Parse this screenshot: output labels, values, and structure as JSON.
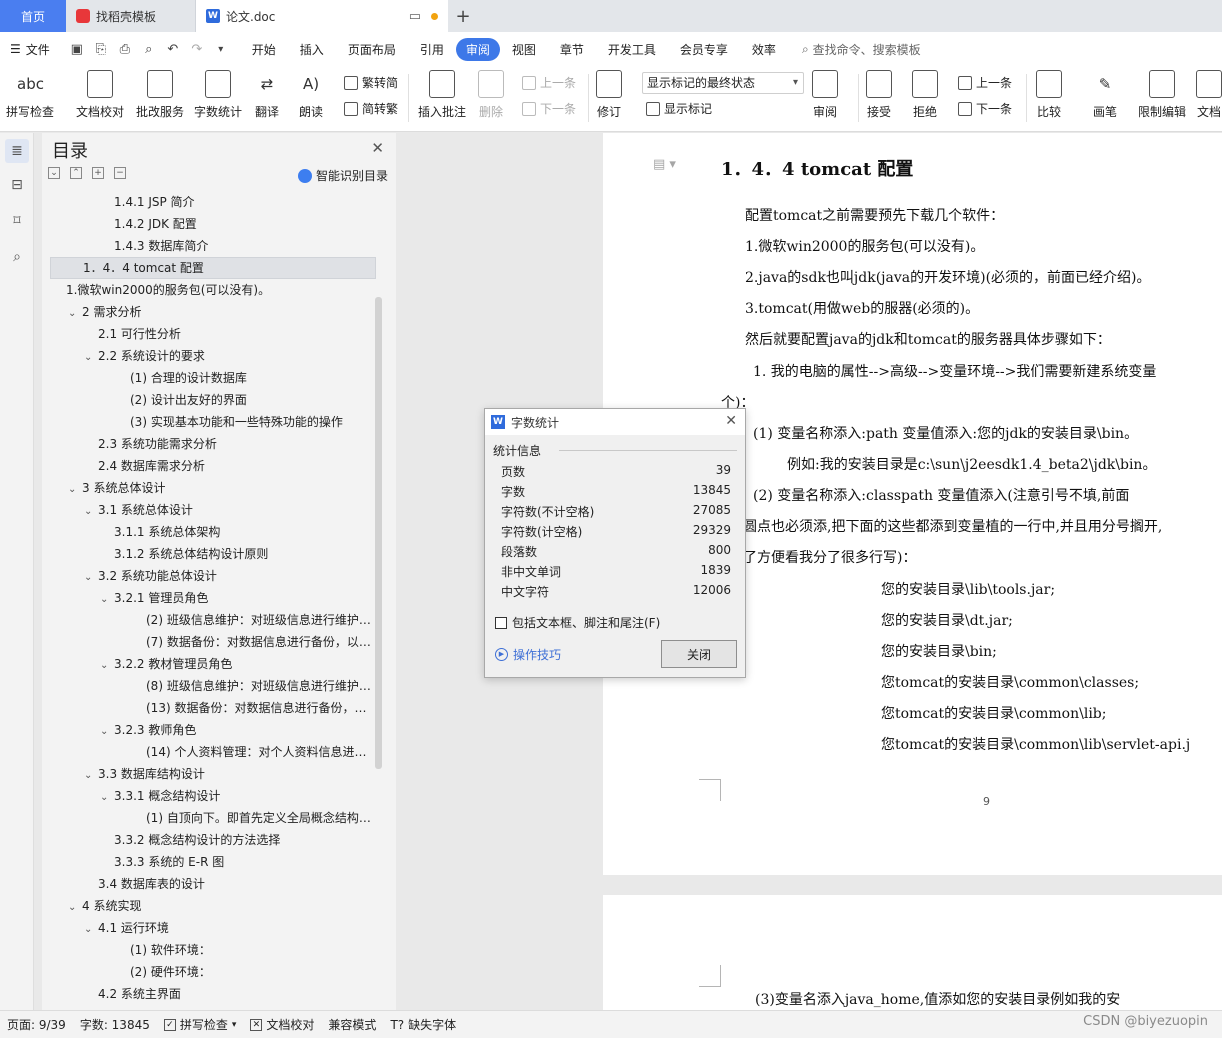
{
  "tabs": [
    {
      "label": "首页"
    },
    {
      "label": "找稻壳模板"
    },
    {
      "label": "论文.doc"
    }
  ],
  "menubar": {
    "file": "文件",
    "items": [
      "开始",
      "插入",
      "页面布局",
      "引用",
      "审阅",
      "视图",
      "章节",
      "开发工具",
      "会员专享",
      "效率"
    ],
    "active": "审阅",
    "search": "查找命令、搜索模板"
  },
  "ribbon": {
    "buttons": [
      "拼写检查",
      "文档校对",
      "批改服务",
      "字数统计",
      "翻译",
      "朗读",
      "插入批注",
      "删除",
      "修订",
      "审阅",
      "接受",
      "拒绝",
      "比较",
      "画笔",
      "限制编辑",
      "文档"
    ],
    "small": {
      "trad": "繁转简",
      "simp": "简转繁",
      "prev_comment": "上一条",
      "next_comment": "下一条",
      "show_markup": "显示标记",
      "prev_change": "上一条",
      "next_change": "下一条"
    },
    "markup_select": "显示标记的最终状态",
    "abc_icon": "abc"
  },
  "toc": {
    "title": "目录",
    "smart": "智能识别目录",
    "items": [
      "1.4.1 JSP 简介",
      "1.4.2 JDK 配置",
      "1.4.3 数据库简介",
      "1．4．4 tomcat 配置",
      "1.微软win2000的服务包(可以没有)。",
      "2 需求分析",
      "2.1 可行性分析",
      "2.2 系统设计的要求",
      "(1) 合理的设计数据库",
      "(2) 设计出友好的界面",
      "(3) 实现基本功能和一些特殊功能的操作",
      "2.3 系统功能需求分析",
      "2.4 数据库需求分析",
      "3 系统总体设计",
      "3.1 系统总体设计",
      "3.1.1 系统总体架构",
      "3.1.2 系统总体结构设计原则",
      "3.2 系统功能总体设计",
      "3.2.1 管理员角色",
      "(2) 班级信息维护：对班级信息进行维护，...",
      "(7) 数据备份：对数据信息进行备份，以免...",
      "3.2.2 教材管理员角色",
      "(8) 班级信息维护：对班级信息进行维护，...",
      "(13) 数据备份：对数据信息进行备份，以...",
      "3.2.3 教师角色",
      "(14) 个人资料管理：对个人资料信息进行...",
      "3.3 数据库结构设计",
      "3.3.1 概念结构设计",
      "(1) 自顶向下。即首先定义全局概念结构的...",
      "3.3.2 概念结构设计的方法选择",
      "3.3.3 系统的 E-R 图",
      "3.4 数据库表的设计",
      "4 系统实现",
      "4.1 运行环境",
      "(1) 软件环境：",
      "(2) 硬件环境：",
      "4.2 系统主界面"
    ]
  },
  "doc": {
    "heading": "1．4．4 tomcat 配置",
    "lines": [
      "配置tomcat之前需要预先下载几个软件：",
      "1.微软win2000的服务包(可以没有)。",
      "2.java的sdk也叫jdk(java的开发环境)(必须的，前面已经介绍)。",
      "3.tomcat(用做web的服器(必须的)。",
      "然后就要配置java的jdk和tomcat的服务器具体步骤如下：",
      "1. 我的电脑的属性-->高级-->变量环境-->我们需要新建系统变量",
      "个)：",
      "(1) 变量名称添入:path    变量值添入:您的jdk的安装目录\\bin。",
      "例如:我的安装目录是c:\\sun\\j2eesdk1.4_beta2\\jdk\\bin。",
      "(2) 变量名称添入:classpath    变量值添入(注意引号不填,前面",
      "圆点也必须添,把下面的这些都添到变量植的一行中,并且用分号搁开,",
      "了方便看我分了很多行写)：",
      "您的安装目录\\lib\\tools.jar;",
      "您的安装目录\\dt.jar;",
      "您的安装目录\\bin;",
      "您tomcat的安装目录\\common\\classes;",
      "您tomcat的安装目录\\common\\lib;",
      "您tomcat的安装目录\\common\\lib\\servlet-api.j"
    ],
    "page_number": "9",
    "page2_line": "(3)变量名添入java_home,值添如您的安装目录例如我的安"
  },
  "dialog": {
    "title": "字数统计",
    "section": "统计信息",
    "stats": [
      {
        "label": "页数",
        "value": "39"
      },
      {
        "label": "字数",
        "value": "13845"
      },
      {
        "label": "字符数(不计空格)",
        "value": "27085"
      },
      {
        "label": "字符数(计空格)",
        "value": "29329"
      },
      {
        "label": "段落数",
        "value": "800"
      },
      {
        "label": "非中文单词",
        "value": "1839"
      },
      {
        "label": "中文字符",
        "value": "12006"
      }
    ],
    "checkbox": "包括文本框、脚注和尾注(F)",
    "tips": "操作技巧",
    "close": "关闭"
  },
  "statusbar": {
    "page": "页面: 9/39",
    "words": "字数: 13845",
    "spell": "拼写检查",
    "proof": "文档校对",
    "compat": "兼容模式",
    "font": "缺失字体"
  },
  "watermark": "CSDN @biyezuopin",
  "colors": {
    "accent": "#3d78e8",
    "home_tab": "#4a7ef0",
    "link": "#3d6fd6"
  }
}
